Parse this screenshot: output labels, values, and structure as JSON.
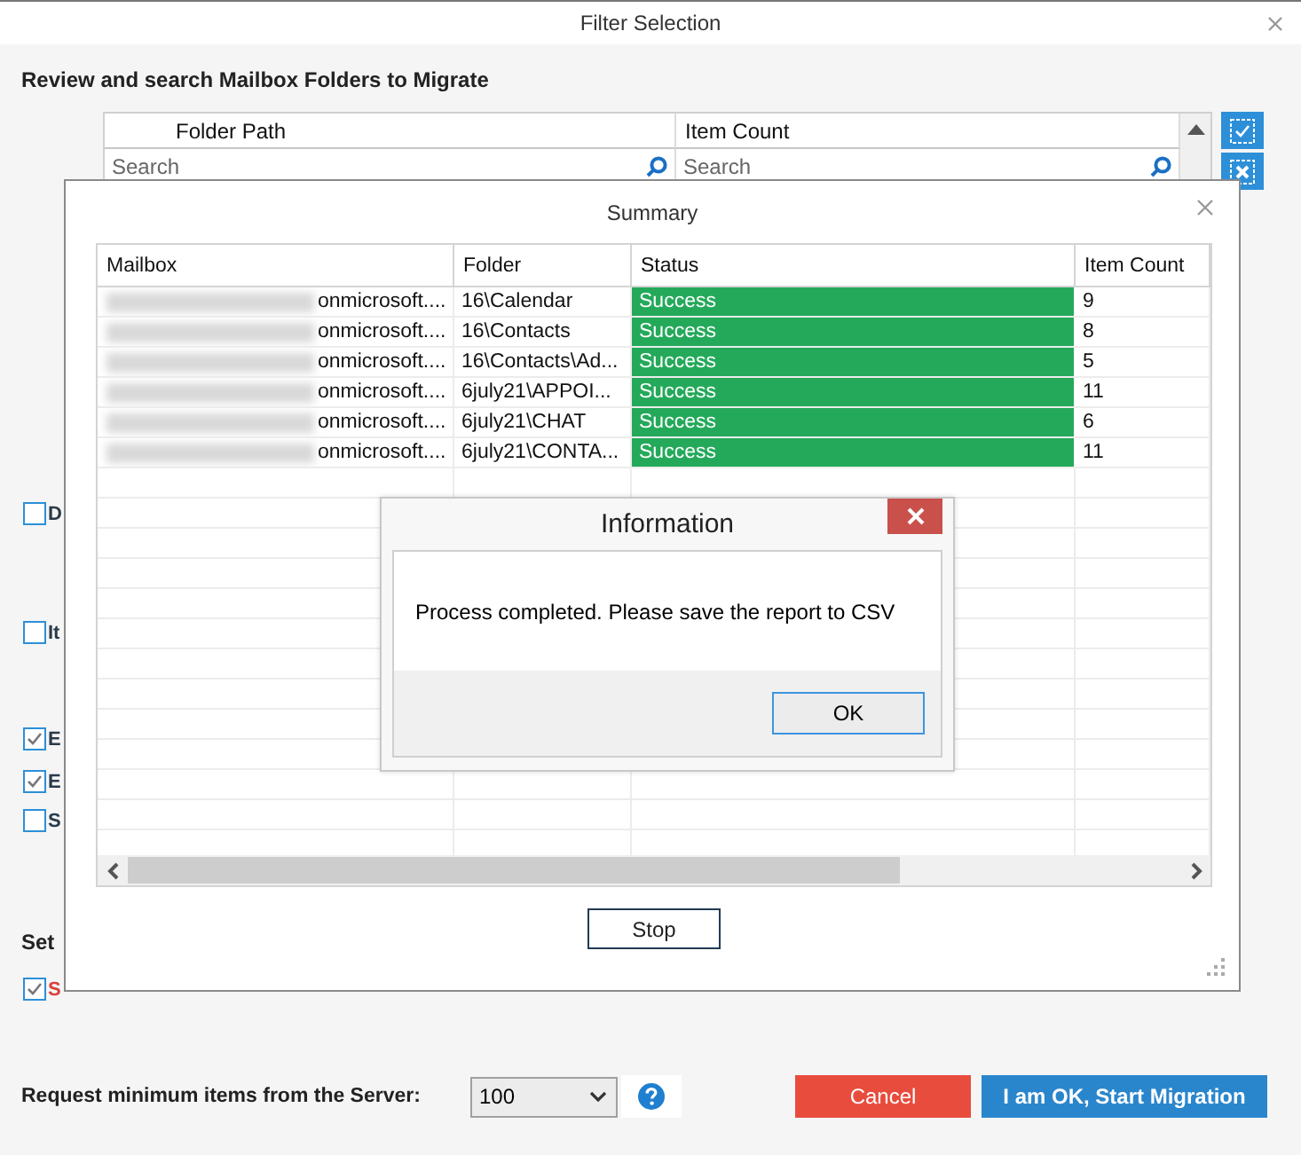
{
  "window": {
    "title": "Filter Selection"
  },
  "heading": "Review and search Mailbox Folders to Migrate",
  "folder_grid": {
    "columns": [
      {
        "label": "Folder Path",
        "placeholder": "Search"
      },
      {
        "label": "Item Count",
        "placeholder": "Search"
      }
    ]
  },
  "options": [
    {
      "label": "D",
      "checked": false
    },
    {
      "label": "It",
      "checked": false
    },
    {
      "label": "E",
      "checked": true
    },
    {
      "label": "E",
      "checked": true
    },
    {
      "label": "S",
      "checked": false
    }
  ],
  "section_label": "Set",
  "section_option": {
    "label": "S",
    "checked": true
  },
  "request": {
    "label": "Request minimum items from the Server:",
    "value": "100"
  },
  "buttons": [
    {
      "label": "Cancel",
      "kind": "cancel"
    },
    {
      "label": "I am OK, Start Migration",
      "kind": "primary"
    }
  ],
  "summary": {
    "title": "Summary",
    "columns": [
      "Mailbox",
      "Folder",
      "Status",
      "Item Count"
    ],
    "rows": [
      {
        "mailbox": "onmicrosoft....",
        "folder": "16\\Calendar",
        "status": "Success",
        "item_count": "9"
      },
      {
        "mailbox": "onmicrosoft....",
        "folder": "16\\Contacts",
        "status": "Success",
        "item_count": "8"
      },
      {
        "mailbox": "onmicrosoft....",
        "folder": "16\\Contacts\\Ad...",
        "status": "Success",
        "item_count": "5"
      },
      {
        "mailbox": "onmicrosoft....",
        "folder": "6july21\\APPOI...",
        "status": "Success",
        "item_count": "11"
      },
      {
        "mailbox": "onmicrosoft....",
        "folder": "6july21\\CHAT",
        "status": "Success",
        "item_count": "6"
      },
      {
        "mailbox": "onmicrosoft....",
        "folder": "6july21\\CONTA...",
        "status": "Success",
        "item_count": "11"
      }
    ],
    "stop_button": "Stop"
  },
  "information": {
    "title": "Information",
    "message": "Process completed. Please save the report to CSV",
    "ok_button": "OK"
  }
}
